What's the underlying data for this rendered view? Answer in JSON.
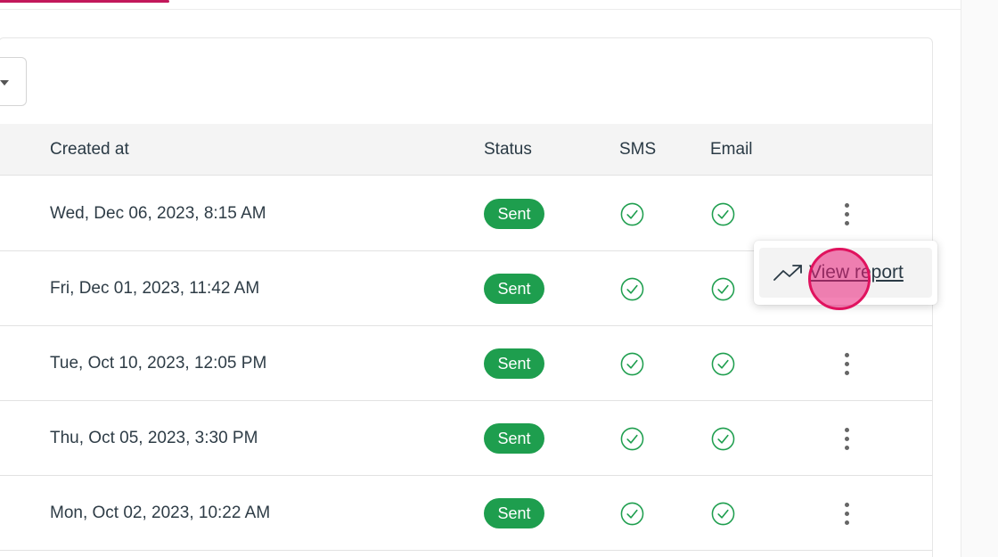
{
  "table": {
    "headers": {
      "created_at": "Created at",
      "status": "Status",
      "sms": "SMS",
      "email": "Email"
    },
    "rows": [
      {
        "created_at": "Wed, Dec 06, 2023, 8:15 AM",
        "status": "Sent",
        "sms": "check-circle-icon",
        "email": "check-circle-icon"
      },
      {
        "created_at": "Fri, Dec 01, 2023, 11:42 AM",
        "status": "Sent",
        "sms": "check-circle-icon",
        "email": "check-circle-icon"
      },
      {
        "created_at": "Tue, Oct 10, 2023, 12:05 PM",
        "status": "Sent",
        "sms": "check-circle-icon",
        "email": "check-circle-icon"
      },
      {
        "created_at": "Thu, Oct 05, 2023, 3:30 PM",
        "status": "Sent",
        "sms": "check-circle-icon",
        "email": "check-circle-icon"
      },
      {
        "created_at": "Mon, Oct 02, 2023, 10:22 AM",
        "status": "Sent",
        "sms": "check-circle-icon",
        "email": "check-circle-icon"
      }
    ]
  },
  "row_menu": {
    "open_row_index": 1,
    "items": [
      {
        "label": "View report",
        "icon": "trending-up-icon"
      }
    ]
  },
  "colors": {
    "accent": "#c2185b",
    "status_sent": "#1e9e4e",
    "check": "#1e9e4e",
    "click_marker": "#e0125e"
  }
}
